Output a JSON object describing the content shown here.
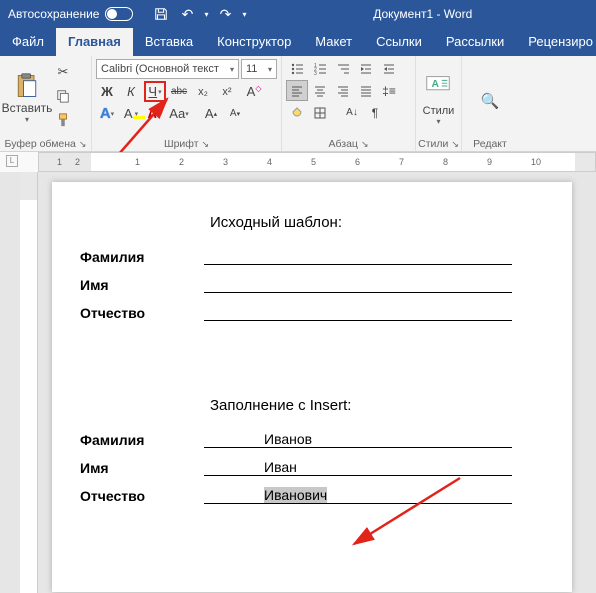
{
  "titlebar": {
    "autosave": "Автосохранение",
    "title": "Документ1 - Word"
  },
  "tabs": {
    "file": "Файл",
    "home": "Главная",
    "insert": "Вставка",
    "design": "Конструктор",
    "layout": "Макет",
    "references": "Ссылки",
    "mailings": "Рассылки",
    "review": "Рецензиро"
  },
  "ribbon": {
    "clipboard": {
      "label": "Буфер обмена",
      "paste": "Вставить"
    },
    "font": {
      "label": "Шрифт",
      "name": "Calibri (Основной текст",
      "size": "11",
      "bold": "Ж",
      "italic": "К",
      "underline": "Ч",
      "strike": "abc",
      "sub": "x₂",
      "sup": "x²",
      "effects": "A",
      "highlight": "A",
      "fontcolor": "A",
      "case": "Aa"
    },
    "para": {
      "label": "Абзац"
    },
    "styles": {
      "label": "Стили",
      "btn": "Стили"
    },
    "editing": {
      "label": "Редакт"
    }
  },
  "document": {
    "template_title": "Исходный шаблон:",
    "lastname": "Фамилия",
    "firstname": "Имя",
    "patronymic": "Отчество",
    "insert_title": "Заполнение с Insert:",
    "val_lastname": "Иванов",
    "val_firstname": "Иван",
    "val_patronymic": "Иванович"
  },
  "ruler": [
    "1",
    "2",
    "1",
    "2",
    "3",
    "4",
    "5",
    "6",
    "7",
    "8",
    "9",
    "10"
  ]
}
